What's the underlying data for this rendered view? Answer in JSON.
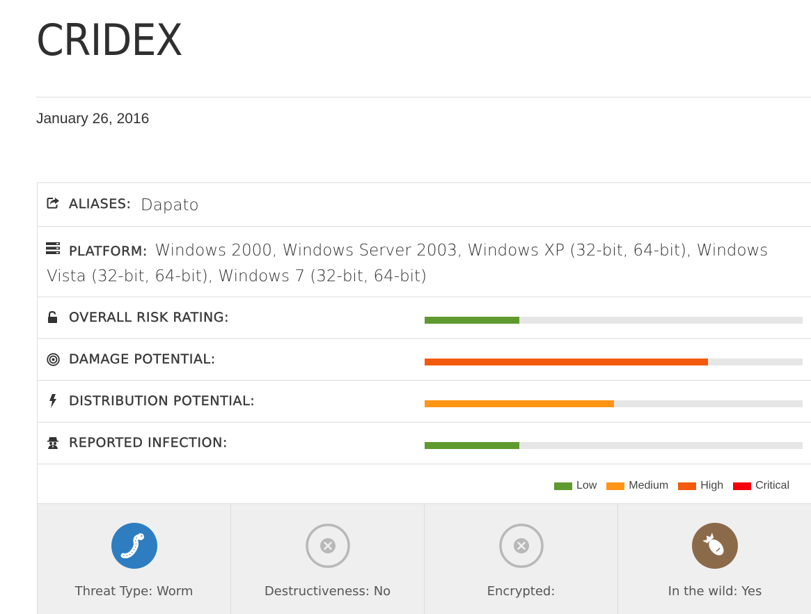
{
  "title": "CRIDEX",
  "date": "January 26, 2016",
  "aliases": {
    "label": "ALIASES:",
    "value": "Dapato",
    "icon": "share-square-icon"
  },
  "platform": {
    "label": "PLATFORM:",
    "value": "Windows 2000, Windows Server 2003, Windows XP (32-bit, 64-bit), Windows Vista (32-bit, 64-bit), Windows 7 (32-bit, 64-bit)",
    "icon": "server-icon"
  },
  "ratings": [
    {
      "label": "OVERALL RISK RATING:",
      "icon": "unlock-icon",
      "level": "Low",
      "fill": 0.25,
      "color": "#5f9a2f"
    },
    {
      "label": "DAMAGE POTENTIAL:",
      "icon": "target-icon",
      "level": "High",
      "fill": 0.75,
      "color": "#f35a0e"
    },
    {
      "label": "DISTRIBUTION POTENTIAL:",
      "icon": "bolt-icon",
      "level": "Medium",
      "fill": 0.5,
      "color": "#ff9516"
    },
    {
      "label": "REPORTED INFECTION:",
      "icon": "spy-icon",
      "level": "Low",
      "fill": 0.25,
      "color": "#5f9a2f"
    }
  ],
  "legend": [
    {
      "label": "Low",
      "color": "#5f9a2f"
    },
    {
      "label": "Medium",
      "color": "#ff9516"
    },
    {
      "label": "High",
      "color": "#f35a0e"
    },
    {
      "label": "Critical",
      "color": "#f3000c"
    }
  ],
  "tiles": [
    {
      "label": "Threat Type: Worm",
      "icon": "worm-icon",
      "color": "#2d7dc0"
    },
    {
      "label": "Destructiveness: No",
      "icon": "x-circle-icon",
      "color": "#b8b8b8"
    },
    {
      "label": "Encrypted:",
      "icon": "x-circle-icon",
      "color": "#b8b8b8"
    },
    {
      "label": "In the wild: Yes",
      "icon": "bomb-icon",
      "color": "#8b6a4a"
    }
  ]
}
